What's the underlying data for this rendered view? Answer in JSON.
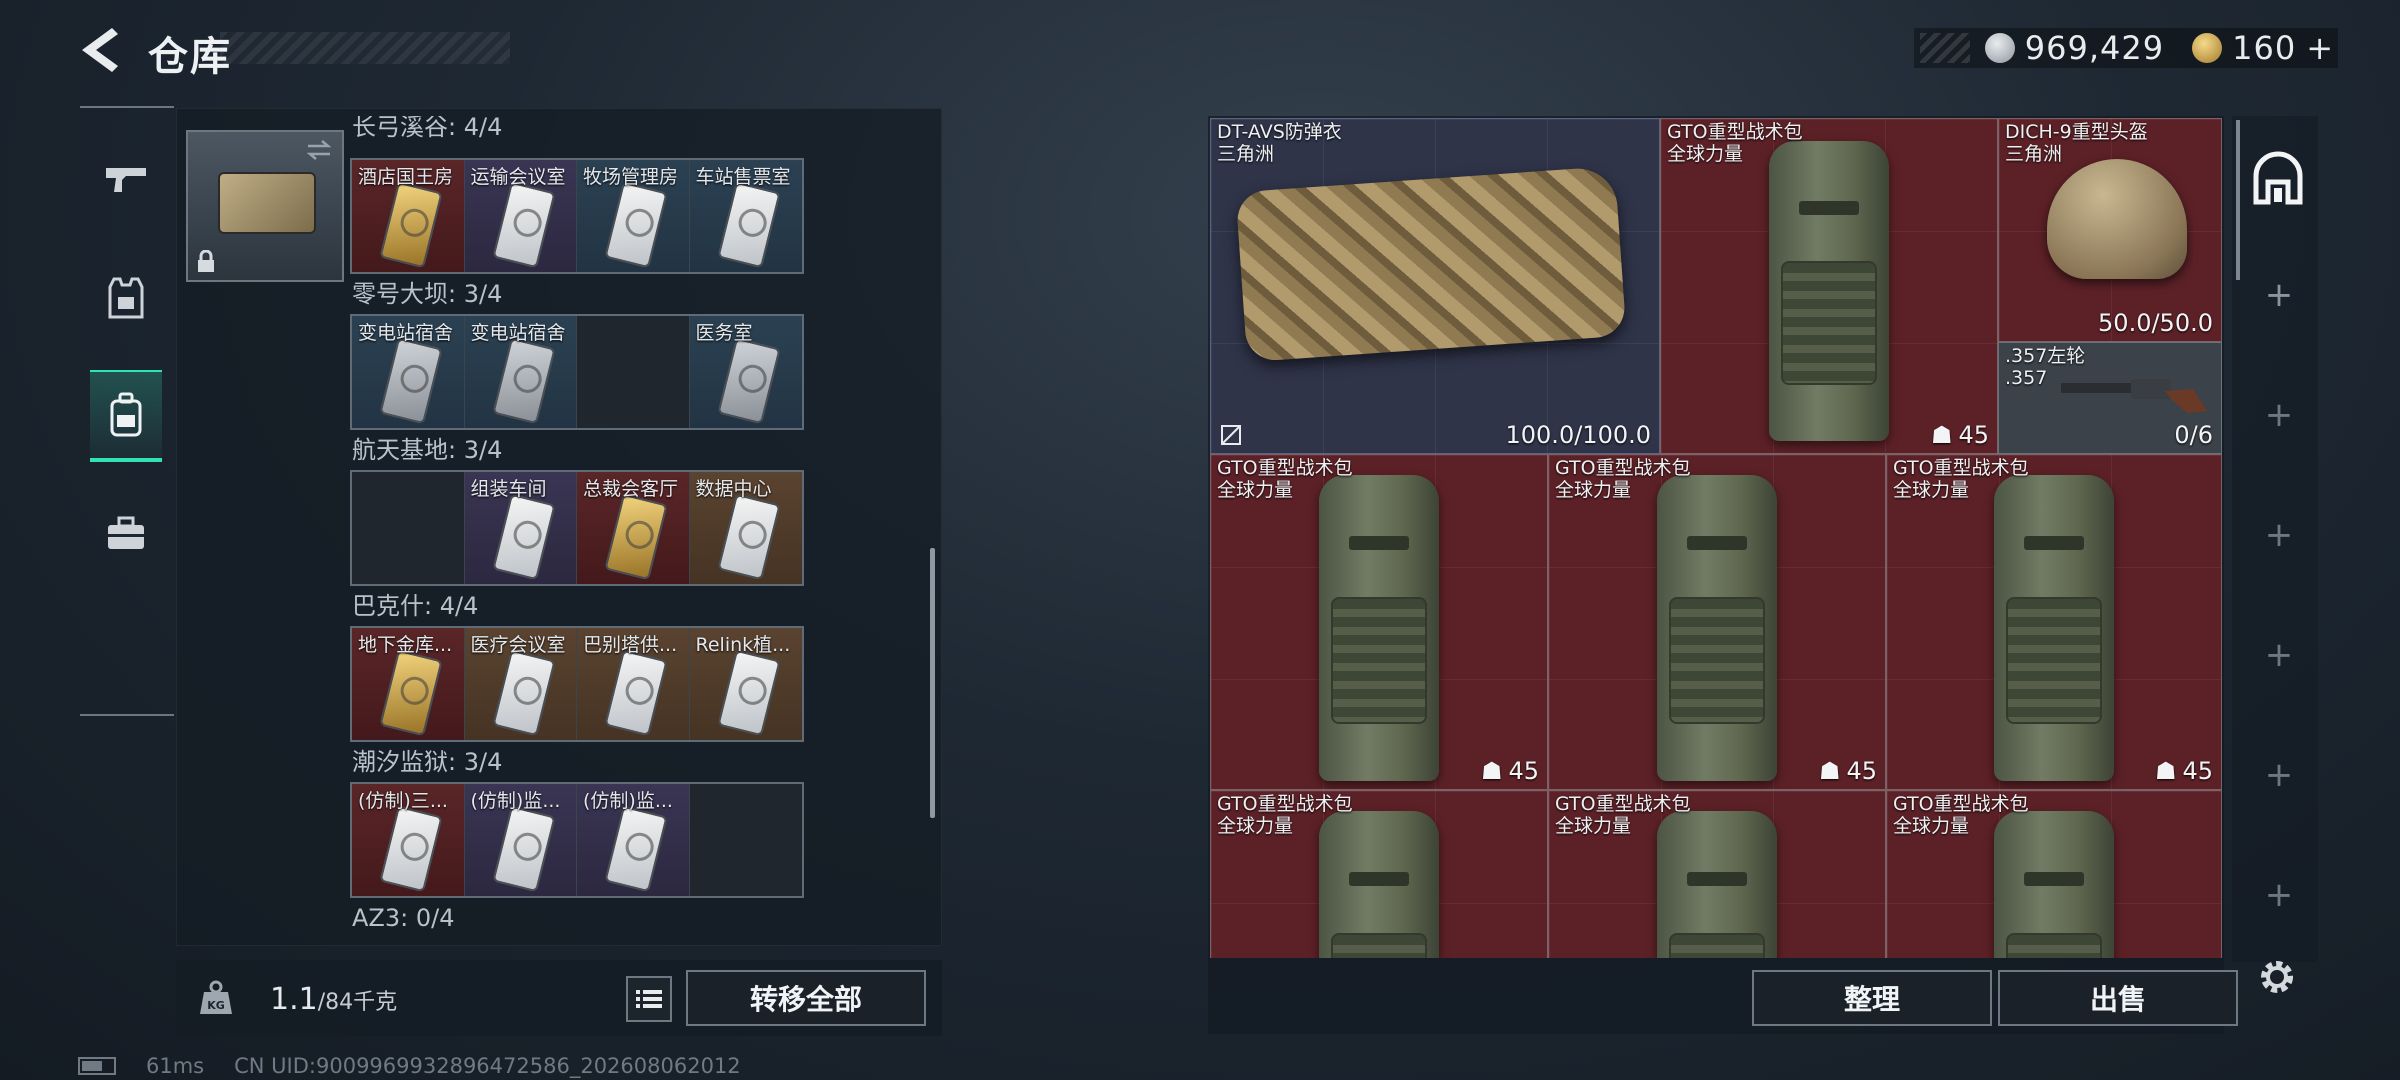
{
  "header": {
    "title": "仓库",
    "currency_silver": "969,429",
    "currency_gold": "160",
    "add_label": "+"
  },
  "left_nav": {
    "items": [
      {
        "icon": "pistol-icon",
        "active": false
      },
      {
        "icon": "armor-vest-icon",
        "active": false
      },
      {
        "icon": "backpack-icon",
        "active": true
      },
      {
        "icon": "toolbox-icon",
        "active": false
      }
    ]
  },
  "key_collection": {
    "groups": [
      {
        "title": "长弓溪谷: 4/4",
        "slots": [
          {
            "label": "酒店国王房",
            "rarity": "red",
            "card": "gold"
          },
          {
            "label": "运输会议室",
            "rarity": "purple",
            "card": "silver"
          },
          {
            "label": "牧场管理房",
            "rarity": "blue",
            "card": "silver"
          },
          {
            "label": "车站售票室",
            "rarity": "blue",
            "card": "silver"
          }
        ]
      },
      {
        "title": "零号大坝: 3/4",
        "slots": [
          {
            "label": "变电站宿舍",
            "rarity": "blue",
            "card": "silver"
          },
          {
            "label": "变电站宿舍",
            "rarity": "blue",
            "card": "silver"
          },
          {
            "label": "",
            "rarity": "empty",
            "card": ""
          },
          {
            "label": "医务室",
            "rarity": "blue",
            "card": "silver"
          }
        ]
      },
      {
        "title": "航天基地: 3/4",
        "slots": [
          {
            "label": "",
            "rarity": "empty",
            "card": ""
          },
          {
            "label": "组装车间",
            "rarity": "purple",
            "card": "silver"
          },
          {
            "label": "总裁会客厅",
            "rarity": "red",
            "card": "gold"
          },
          {
            "label": "数据中心",
            "rarity": "brown",
            "card": "silver"
          }
        ]
      },
      {
        "title": "巴克什: 4/4",
        "slots": [
          {
            "label": "地下金库...",
            "rarity": "red",
            "card": "gold"
          },
          {
            "label": "医疗会议室",
            "rarity": "brown",
            "card": "silver"
          },
          {
            "label": "巴别塔供...",
            "rarity": "brown",
            "card": "silver"
          },
          {
            "label": "Relink植...",
            "rarity": "brown",
            "card": "silver"
          }
        ]
      },
      {
        "title": "潮汐监狱: 3/4",
        "slots": [
          {
            "label": "(仿制)三...",
            "rarity": "red",
            "card": "silver"
          },
          {
            "label": "(仿制)监...",
            "rarity": "purple",
            "card": "silver"
          },
          {
            "label": "(仿制)监...",
            "rarity": "purple",
            "card": "silver"
          },
          {
            "label": "",
            "rarity": "empty",
            "card": ""
          }
        ]
      },
      {
        "title": "AZ3: 0/4",
        "slots": []
      }
    ]
  },
  "weight": {
    "current": "1.1",
    "max": "/84千克",
    "kg_label": "KG"
  },
  "buttons": {
    "transfer_all": "转移全部",
    "sort": "整理",
    "sell": "出售"
  },
  "inventory": {
    "items": [
      {
        "name": "DT-AVS防弹衣",
        "sub": "三角洲",
        "value": "100.0/100.0",
        "rarity": "purple",
        "kind": "vest"
      },
      {
        "name": "GTO重型战术包",
        "sub": "全球力量",
        "value": "45",
        "rarity": "red",
        "kind": "pack"
      },
      {
        "name": "DICH-9重型头盔",
        "sub": "三角洲",
        "value": "50.0/50.0",
        "rarity": "red",
        "kind": "helmet"
      },
      {
        "name": ".357左轮",
        "sub": ".357",
        "value": "0/6",
        "rarity": "grey",
        "kind": "revolver"
      },
      {
        "name": "GTO重型战术包",
        "sub": "全球力量",
        "value": "45",
        "rarity": "red",
        "kind": "pack"
      },
      {
        "name": "GTO重型战术包",
        "sub": "全球力量",
        "value": "45",
        "rarity": "red",
        "kind": "pack"
      },
      {
        "name": "GTO重型战术包",
        "sub": "全球力量",
        "value": "45",
        "rarity": "red",
        "kind": "pack"
      },
      {
        "name": "GTO重型战术包",
        "sub": "全球力量",
        "value": "",
        "rarity": "red",
        "kind": "pack"
      },
      {
        "name": "GTO重型战术包",
        "sub": "全球力量",
        "value": "",
        "rarity": "red",
        "kind": "pack"
      },
      {
        "name": "GTO重型战术包",
        "sub": "全球力量",
        "value": "",
        "rarity": "red",
        "kind": "pack"
      }
    ]
  },
  "status": {
    "ping": "61ms",
    "uid": "CN UID:9009969932896472586_202608062012"
  },
  "colors": {
    "accent_active": "#2fe3b4",
    "rarity_red": "#5c2127",
    "rarity_purple": "#2f3449"
  }
}
